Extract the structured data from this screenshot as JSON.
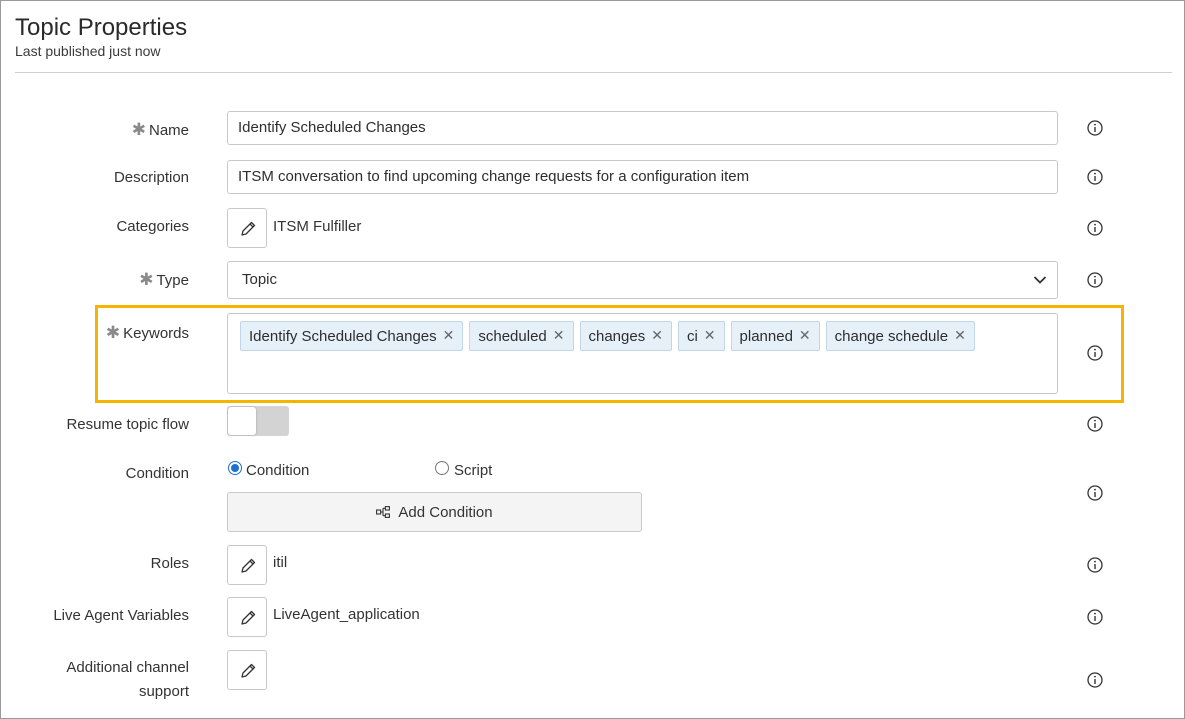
{
  "header": {
    "title": "Topic Properties",
    "subtitle": "Last published just now"
  },
  "fields": {
    "name": {
      "label": "Name",
      "required": "✱",
      "value": "Identify Scheduled Changes"
    },
    "description": {
      "label": "Description",
      "value": "ITSM conversation to find upcoming change requests for a configuration item"
    },
    "categories": {
      "label": "Categories",
      "value": "ITSM Fulfiller"
    },
    "type": {
      "label": "Type",
      "required": "✱",
      "value": "Topic"
    },
    "keywords": {
      "label": "Keywords",
      "required": "✱",
      "chips": [
        "Identify Scheduled Changes",
        "scheduled",
        "changes",
        "ci",
        "planned",
        "change schedule"
      ],
      "remove_glyph": "✕"
    },
    "resume_topic_flow": {
      "label": "Resume topic flow",
      "toggle_on": false
    },
    "condition": {
      "label": "Condition",
      "options": [
        "Condition",
        "Script"
      ],
      "selected": "Condition",
      "add_button": "Add Condition"
    },
    "roles": {
      "label": "Roles",
      "value": "itil"
    },
    "live_agent_variables": {
      "label": "Live Agent Variables",
      "value": "LiveAgent_application"
    },
    "additional_channel_support": {
      "label": "Additional channel support",
      "value": ""
    }
  },
  "colors": {
    "highlight": "#f5b400",
    "chip_bg": "#e6f0f8",
    "radio_selected": "#1f6fd1"
  },
  "icons": [
    "info-icon",
    "pencil-icon",
    "chevron-down-icon",
    "remove-icon",
    "flow-icon"
  ]
}
